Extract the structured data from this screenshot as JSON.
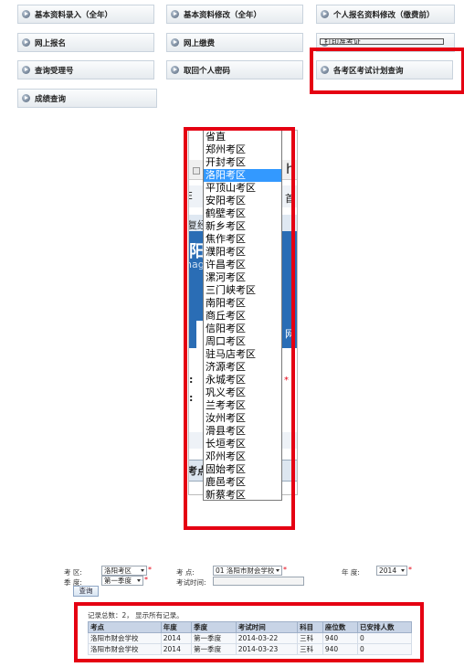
{
  "menu": [
    {
      "label": "基本资料录入（全年）"
    },
    {
      "label": "基本资料修改（全年）"
    },
    {
      "label": "个人报名资料修改（缴费前）"
    },
    {
      "label": "网上报名"
    },
    {
      "label": "网上缴费"
    },
    {
      "label": "打印准考证"
    },
    {
      "label": "查询受理号"
    },
    {
      "label": "取回个人密码"
    },
    {
      "label": "各考区考试计划查询"
    },
    {
      "label": "成绩查询"
    }
  ],
  "browser_fragment": {
    "address_suffix": "h",
    "toolbar_letter": "E",
    "toolbar_right": "首",
    "nav_text": "复经",
    "banner_char": "阳",
    "banner_text": "nag",
    "side_char": "网"
  },
  "dropdown": {
    "options": [
      "省直",
      "郑州考区",
      "开封考区",
      "洛阳考区",
      "平顶山考区",
      "安阳考区",
      "鹤壁考区",
      "新乡考区",
      "焦作考区",
      "濮阳考区",
      "许昌考区",
      "漯河考区",
      "三门峡考区",
      "南阳考区",
      "商丘考区",
      "信阳考区",
      "周口考区",
      "驻马店考区",
      "济源考区",
      "永城考区",
      "巩义考区",
      "兰考考区",
      "汝州考区",
      "滑县考区",
      "长垣考区",
      "邓州考区",
      "固始考区",
      "鹿邑考区",
      "新蔡考区"
    ],
    "selected_index": 3
  },
  "form": {
    "kaoqu_label": "考  区:",
    "kaoqu_value": "洛阳考区",
    "kaodian_label": "考  点:",
    "kaodian_value": "01 洛阳市财会学校",
    "niandu_label": "年  度:",
    "niandu_value": "2014",
    "jidu_label": "季  度:",
    "jidu_value": "第一季度",
    "shijian_label": "考试时间:",
    "req_mark": "*",
    "query_label": "查询"
  },
  "results": {
    "summary": "记录总数：2， 显示所有记录。",
    "columns": [
      "考点",
      "年度",
      "季度",
      "考试时间",
      "科目",
      "座位数",
      "已安排人数"
    ],
    "rows": [
      [
        "洛阳市财会学校",
        "2014",
        "第一季度",
        "2014-03-22",
        "三科",
        "940",
        "0"
      ],
      [
        "洛阳市财会学校",
        "2014",
        "第一季度",
        "2014-03-23",
        "三科",
        "940",
        "0"
      ]
    ]
  },
  "colors": {
    "highlight_red": "#e50012",
    "selected_blue": "#3399ff"
  }
}
